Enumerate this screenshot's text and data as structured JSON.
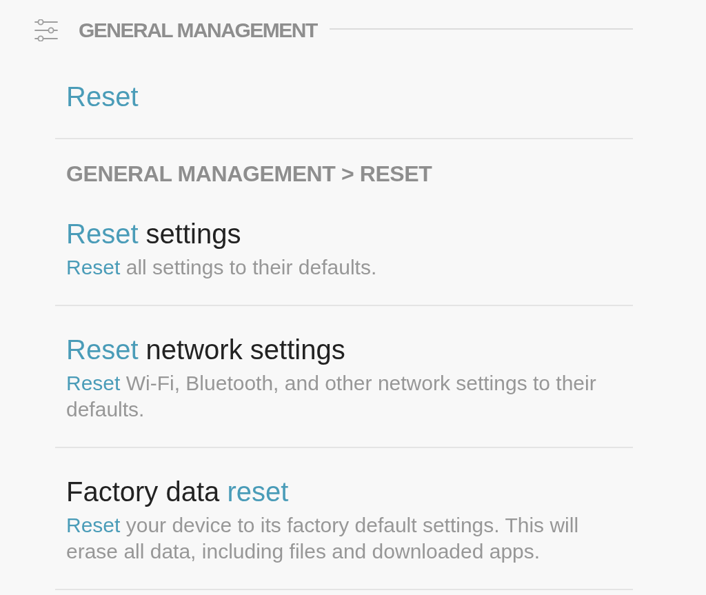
{
  "section": {
    "title": "GENERAL MANAGEMENT"
  },
  "menu_result": {
    "title": [
      {
        "text": "Reset",
        "match": true
      }
    ]
  },
  "breadcrumb": "GENERAL MANAGEMENT > RESET",
  "results": [
    {
      "title": [
        {
          "text": "Reset",
          "match": true
        },
        {
          "text": " settings",
          "match": false
        }
      ],
      "description": [
        {
          "text": "Reset",
          "match": true
        },
        {
          "text": " all settings to their defaults.",
          "match": false
        }
      ]
    },
    {
      "title": [
        {
          "text": "Reset",
          "match": true
        },
        {
          "text": " network settings",
          "match": false
        }
      ],
      "description": [
        {
          "text": "Reset",
          "match": true
        },
        {
          "text": " Wi-Fi, Bluetooth, and other network settings to their defaults.",
          "match": false
        }
      ]
    },
    {
      "title": [
        {
          "text": "Factory data ",
          "match": false
        },
        {
          "text": "reset",
          "match": true
        }
      ],
      "description": [
        {
          "text": "Reset",
          "match": true
        },
        {
          "text": " your device to its factory default settings. This will erase all data, including files and downloaded apps.",
          "match": false
        }
      ]
    }
  ]
}
